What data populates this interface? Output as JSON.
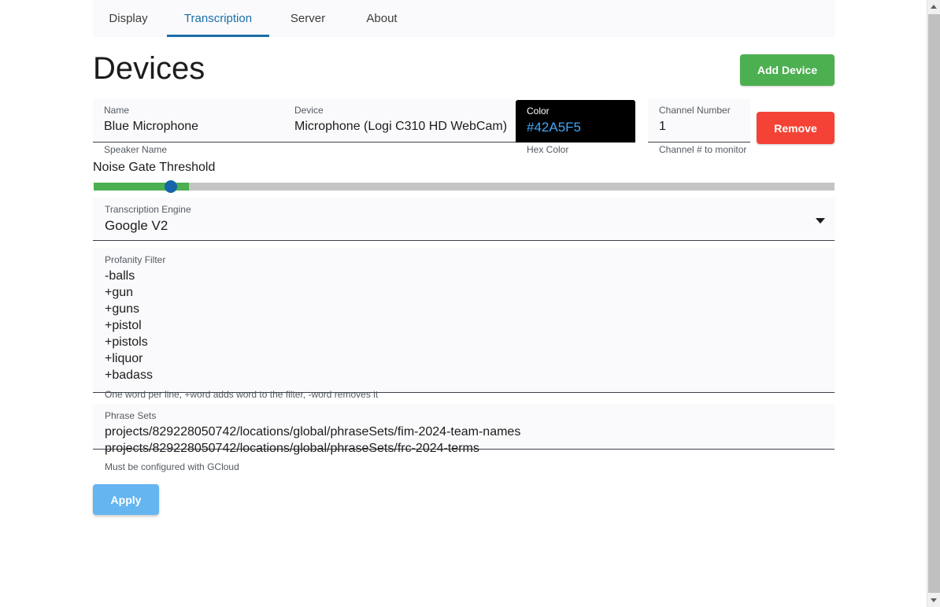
{
  "tabs": [
    {
      "label": "Display",
      "active": false
    },
    {
      "label": "Transcription",
      "active": true
    },
    {
      "label": "Server",
      "active": false
    },
    {
      "label": "About",
      "active": false
    }
  ],
  "header": {
    "title": "Devices",
    "add_device_label": "Add Device"
  },
  "device": {
    "name": {
      "label": "Name",
      "value": "Blue Microphone",
      "helper": "Speaker Name"
    },
    "device_select": {
      "label": "Device",
      "value": "Microphone (Logi C310 HD WebCam)"
    },
    "color": {
      "label": "Color",
      "value": "#42A5F5",
      "helper": "Hex Color",
      "swatch_hex": "#42A5F5",
      "panel_hex": "#000000"
    },
    "channel": {
      "label": "Channel Number",
      "value": "1",
      "helper": "Channel # to monitor"
    },
    "remove_label": "Remove"
  },
  "noise_gate": {
    "label": "Noise Gate Threshold",
    "value_percent": 13,
    "fill_hex": "#4CAF50",
    "thumb_hex": "#1565A8",
    "track_hex": "#C4C4C4"
  },
  "engine": {
    "label": "Transcription Engine",
    "value": "Google V2"
  },
  "profanity": {
    "label": "Profanity Filter",
    "lines": [
      "-balls",
      "+gun",
      "+guns",
      "+pistol",
      "+pistols",
      "+liquor",
      "+badass"
    ],
    "helper": "One word per line, +word adds word to the filter, -word removes it"
  },
  "phrase_sets": {
    "label": "Phrase Sets",
    "lines": [
      "projects/829228050742/locations/global/phraseSets/fim-2024-team-names",
      "projects/829228050742/locations/global/phraseSets/frc-2024-terms"
    ],
    "helper": "Must be configured with GCloud"
  },
  "footer": {
    "apply_label": "Apply"
  },
  "colors": {
    "accent_tab": "#1A6EA8",
    "add_device_green": "#4CAF50",
    "remove_red": "#F44336",
    "apply_blue": "#64B5F0",
    "panel_bg": "#FAFAFC"
  }
}
